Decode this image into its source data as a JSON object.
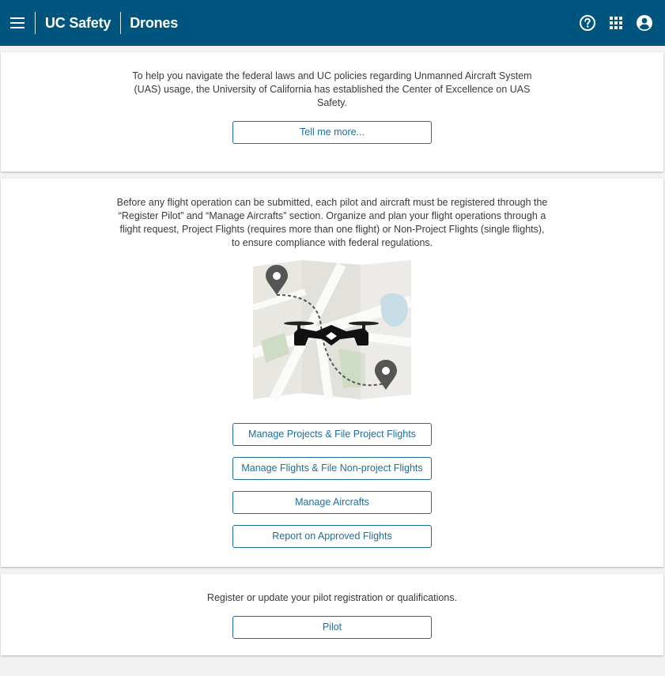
{
  "header": {
    "brand": "UC Safety",
    "app_name": "Drones",
    "icons": [
      "menu-icon",
      "help-icon",
      "apps-grid-icon",
      "account-icon"
    ]
  },
  "intro": {
    "text": "To help you navigate the federal laws and UC policies regarding Unmanned Aircraft System (UAS) usage, the University of California has established the Center of Excellence on UAS Safety.",
    "button": "Tell me more..."
  },
  "operations": {
    "text": "Before any flight operation can be submitted, each pilot and aircraft must be registered through the “Register Pilot” and “Manage Aircrafts” section. Organize and plan your flight operations through a flight request, Project Flights (requires more than one flight) or Non-Project Flights (single flights), to ensure compliance with federal regulations.",
    "buttons": {
      "projects": "Manage Projects & File Project Flights",
      "flights": "Manage Flights & File Non-project Flights",
      "aircrafts": "Manage Aircrafts",
      "report": "Report on Approved Flights"
    }
  },
  "pilot": {
    "text": "Register or update your pilot registration or qualifications.",
    "button": "Pilot"
  },
  "colors": {
    "header_bg": "#00557f",
    "accent": "#1f6e9c",
    "page_bg": "#f2f2f2"
  }
}
